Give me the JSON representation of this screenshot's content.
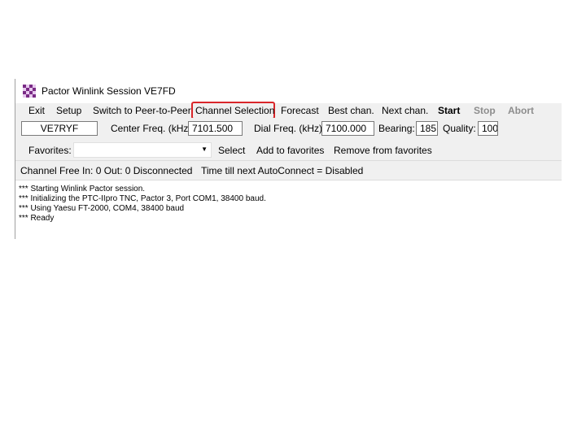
{
  "window": {
    "title": "Pactor Winlink Session VE7FD"
  },
  "menu": {
    "exit": "Exit",
    "setup": "Setup",
    "switch": "Switch to Peer-to-Peer",
    "channel_selection": "Channel Selection",
    "forecast": "Forecast",
    "best_chan": "Best chan.",
    "next_chan": "Next chan.",
    "start": "Start",
    "stop": "Stop",
    "abort": "Abort"
  },
  "params": {
    "callsign": "VE7RYF",
    "center_freq_label": "Center Freq. (kHz):",
    "center_freq_value": "7101.500",
    "dial_freq_label": "Dial Freq. (kHz):",
    "dial_freq_value": "7100.000",
    "bearing_label": "Bearing:",
    "bearing_value": "185",
    "quality_label": "Quality:",
    "quality_value": "100"
  },
  "favorites": {
    "label": "Favorites:",
    "value": "",
    "select": "Select",
    "add": "Add to favorites",
    "remove": "Remove from favorites"
  },
  "status": {
    "text": "Channel Free  In: 0  Out: 0  Disconnected",
    "autoconnect": "Time till next AutoConnect = Disabled"
  },
  "log": [
    "*** Starting Winlink Pactor session.",
    "*** Initializing the PTC-IIpro TNC,  Pactor 3,  Port COM1, 38400 baud.",
    "*** Using Yaesu FT-2000, COM4, 38400 baud",
    "*** Ready"
  ],
  "colors": {
    "highlight": "#d9262a",
    "toolbar_bg": "#f0f0f0",
    "disabled_text": "#8d8d8d"
  }
}
